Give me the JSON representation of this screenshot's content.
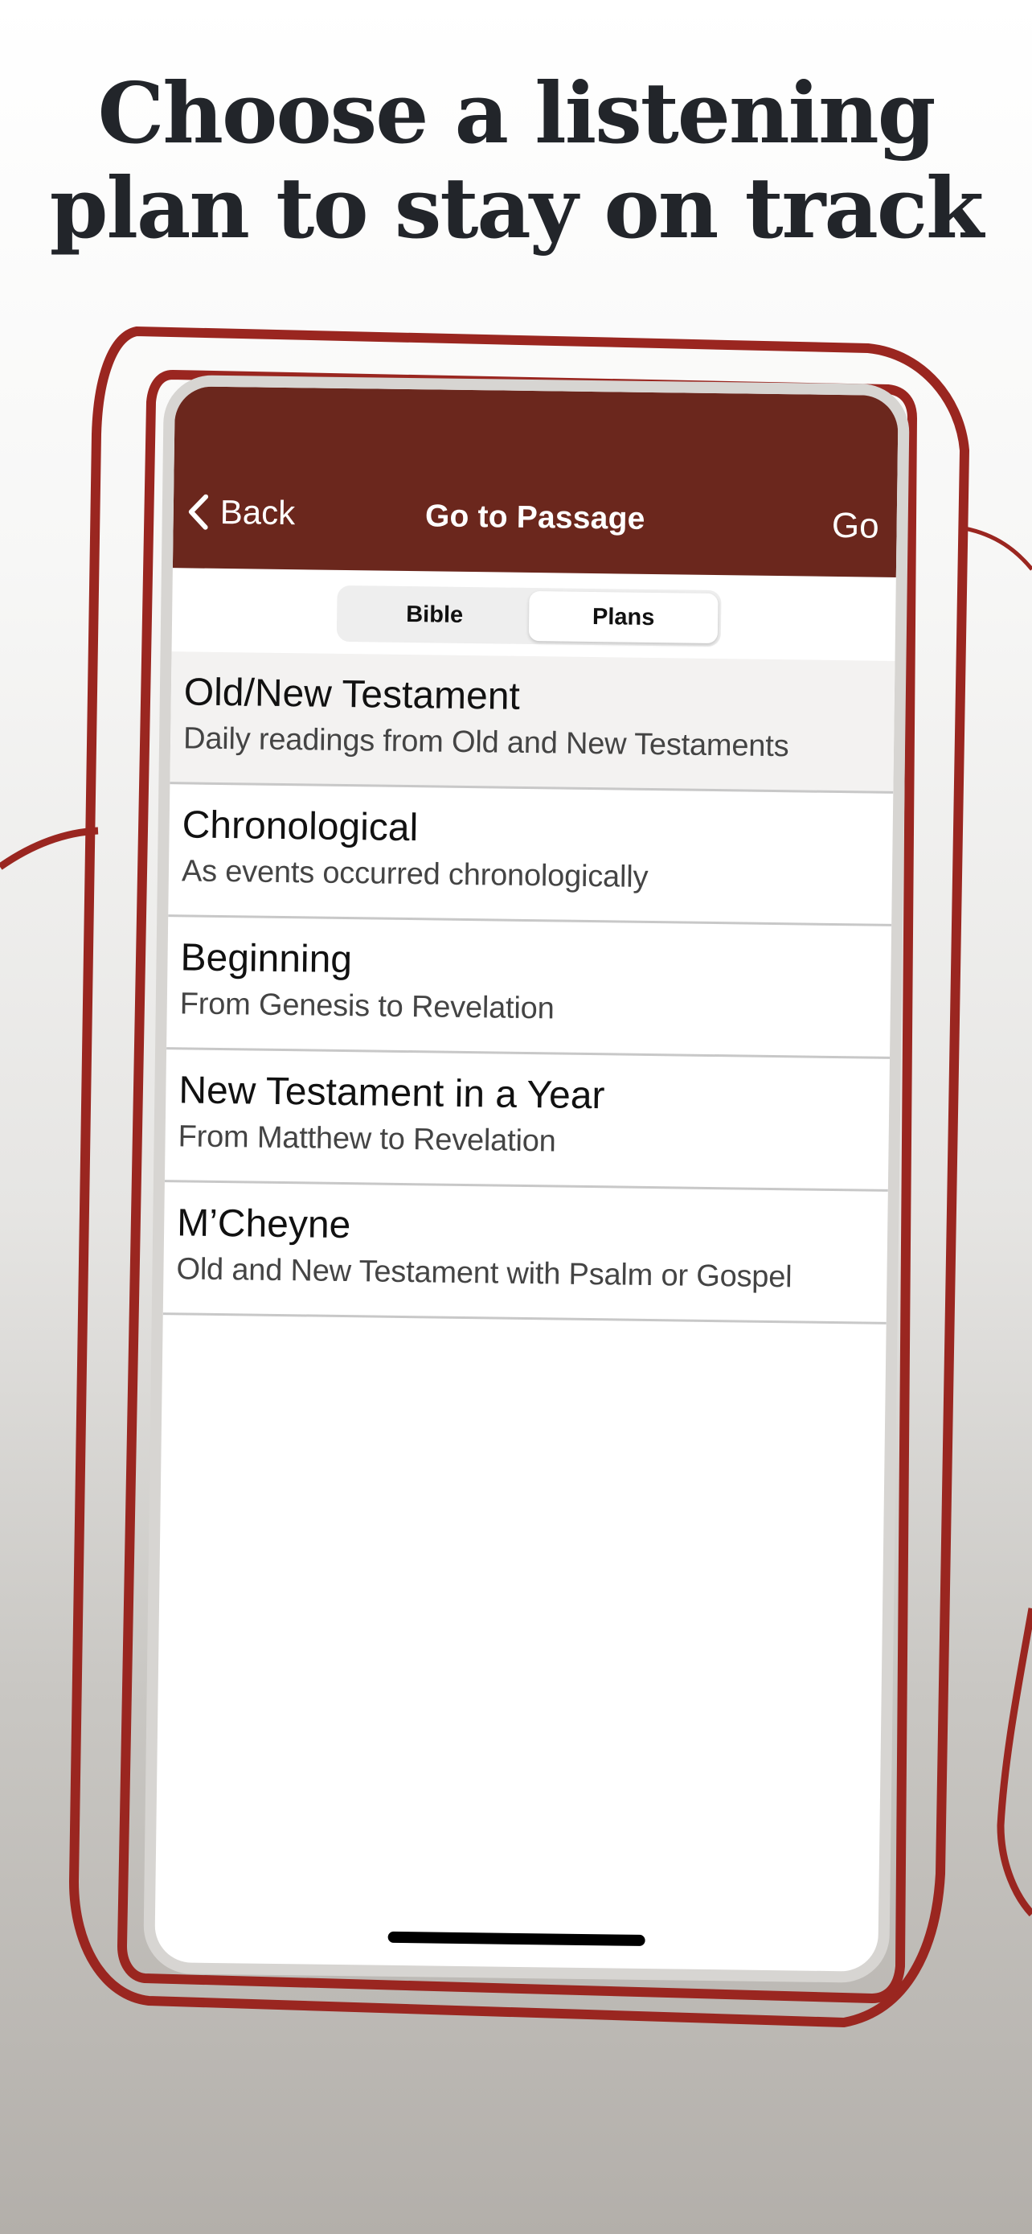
{
  "headline": {
    "line1": "Choose a listening",
    "line2": "plan to stay on track"
  },
  "colors": {
    "navbar": "#6b271d",
    "outline": "#9a2620",
    "headline_text": "#22252a"
  },
  "nav": {
    "back_label": "Back",
    "back_icon": "chevron-left-icon",
    "title": "Go to Passage",
    "go_label": "Go"
  },
  "segmented": {
    "options": [
      "Bible",
      "Plans"
    ],
    "selected": "Plans"
  },
  "plans": [
    {
      "title": "Old/New Testament",
      "subtitle": "Daily readings from Old and New Testaments",
      "selected": true
    },
    {
      "title": "Chronological",
      "subtitle": "As events occurred chronologically",
      "selected": false
    },
    {
      "title": "Beginning",
      "subtitle": "From Genesis to Revelation",
      "selected": false
    },
    {
      "title": "New Testament in a Year",
      "subtitle": "From Matthew to Revelation",
      "selected": false
    },
    {
      "title": "M’Cheyne",
      "subtitle": "Old and New Testament with Psalm or Gospel",
      "selected": false
    }
  ]
}
